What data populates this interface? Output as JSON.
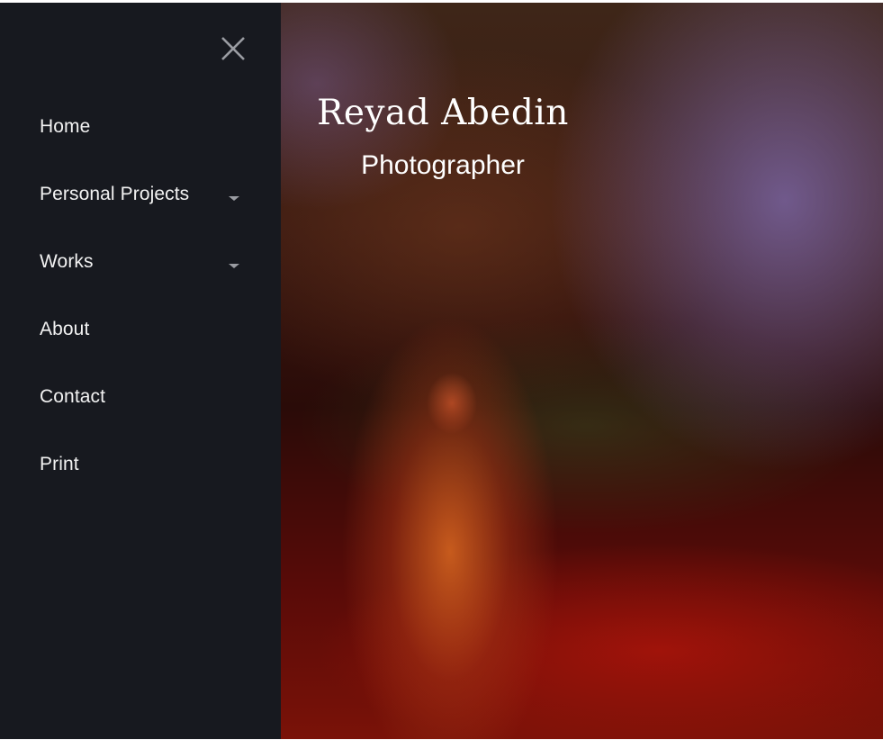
{
  "menu": {
    "close_icon": "close-icon",
    "items": [
      {
        "label": "Home",
        "has_dropdown": false
      },
      {
        "label": "Personal Projects",
        "has_dropdown": true
      },
      {
        "label": "Works",
        "has_dropdown": true
      },
      {
        "label": "About",
        "has_dropdown": false
      },
      {
        "label": "Contact",
        "has_dropdown": false
      },
      {
        "label": "Print",
        "has_dropdown": false
      }
    ]
  },
  "hero": {
    "title": "Reyad Abedin",
    "subtitle": "Photographer"
  },
  "colors": {
    "sidebar_bg": "#17191f",
    "menu_text": "#f2f2f2",
    "caret": "#9a9ca2",
    "close_icon": "#9a9ca2"
  }
}
